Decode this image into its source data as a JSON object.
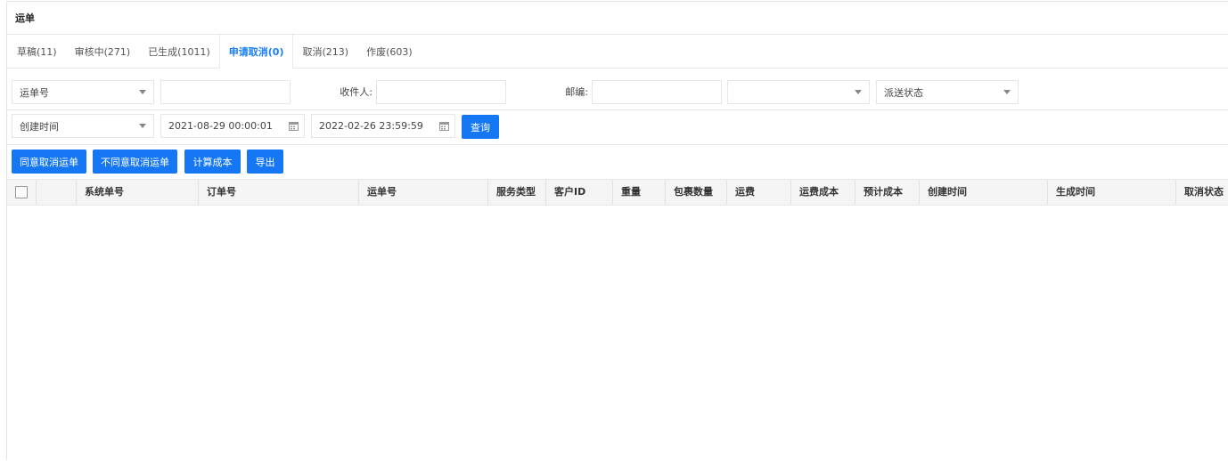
{
  "title": "运单",
  "tabs": [
    {
      "label": "草稿(11)"
    },
    {
      "label": "审核中(271)"
    },
    {
      "label": "已生成(1011)"
    },
    {
      "label": "申请取消(0)",
      "active": true
    },
    {
      "label": "取消(213)"
    },
    {
      "label": "作废(603)"
    }
  ],
  "filters": {
    "waybill_select": "运单号",
    "waybill_input": "",
    "recipient_label": "收件人:",
    "recipient_input": "",
    "postcode_label": "邮编:",
    "postcode_input": "",
    "unnamed_select": "",
    "delivery_status_select": "派送状态",
    "time_type_select": "创建时间",
    "start_date": "2021-08-29 00:00:01",
    "end_date": "2022-02-26 23:59:59",
    "query_button": "查询"
  },
  "actions": {
    "agree_cancel": "同意取消运单",
    "disagree_cancel": "不同意取消运单",
    "calc_cost": "计算成本",
    "export": "导出"
  },
  "table": {
    "columns": [
      "系统单号",
      "订单号",
      "运单号",
      "服务类型",
      "客户ID",
      "重量",
      "包裹数量",
      "运费",
      "运费成本",
      "预计成本",
      "创建时间",
      "生成时间",
      "取消状态"
    ],
    "rows": []
  },
  "colors": {
    "accent": "#1677f5",
    "active_tab": "#1a7ff5"
  }
}
